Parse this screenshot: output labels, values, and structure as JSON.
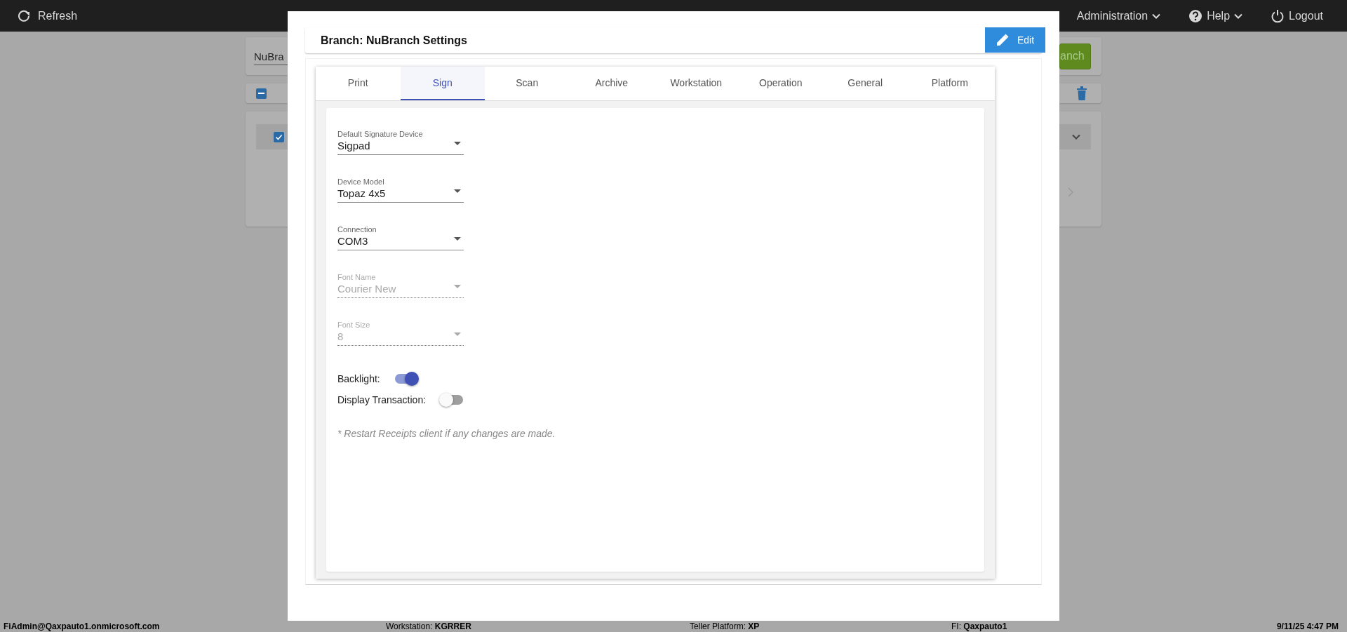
{
  "top_bar": {
    "refresh": "Refresh",
    "menu": [
      {
        "label": "Administration",
        "kind": "dropdown"
      },
      {
        "label": "Help",
        "kind": "help"
      },
      {
        "label": "Logout",
        "kind": "logout"
      }
    ]
  },
  "background_page": {
    "branch_field": {
      "value": "NuBra"
    },
    "add_button": "anch",
    "select_all": {
      "indeterminate": true
    },
    "row": {
      "checked": true
    }
  },
  "modal": {
    "title": "Branch: NuBranch Settings",
    "edit_button": "Edit",
    "tabs": [
      {
        "label": "Print",
        "selected": false
      },
      {
        "label": "Sign",
        "selected": true
      },
      {
        "label": "Scan",
        "selected": false
      },
      {
        "label": "Archive",
        "selected": false
      },
      {
        "label": "Workstation",
        "selected": false
      },
      {
        "label": "Operation",
        "selected": false
      },
      {
        "label": "General",
        "selected": false
      },
      {
        "label": "Platform",
        "selected": false
      }
    ],
    "fields": [
      {
        "label": "Default Signature Device",
        "value": "Sigpad",
        "disabled": false
      },
      {
        "label": "Device Model",
        "value": "Topaz 4x5",
        "disabled": false
      },
      {
        "label": "Connection",
        "value": "COM3",
        "disabled": false
      },
      {
        "label": "Font Name",
        "value": "Courier New",
        "disabled": true
      },
      {
        "label": "Font Size",
        "value": "8",
        "disabled": true
      }
    ],
    "toggles": [
      {
        "label": "Backlight:",
        "on": true
      },
      {
        "label": "Display Transaction:",
        "on": false
      }
    ],
    "note": "* Restart Receipts client if any changes are made."
  },
  "status_bar": [
    "FiAdmin@Qaxpauto1.onmicrosoft.com",
    "Workstation: **KGRRER**",
    "Teller Platform: **XP**",
    "FI: **Qaxpauto1**",
    "9/11/25 4:47 PM"
  ]
}
